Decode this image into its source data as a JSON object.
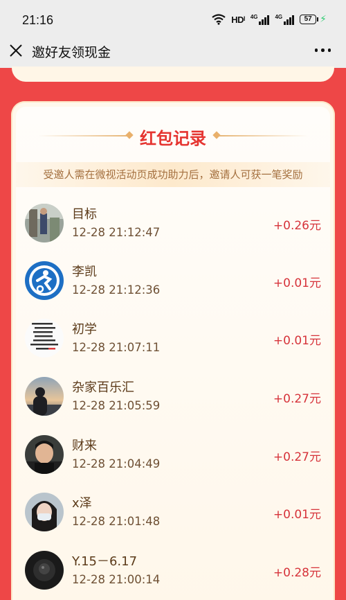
{
  "status_bar": {
    "time": "21:16",
    "network_label": "HDᴵ",
    "signal_tag": "4G",
    "battery": "57",
    "charging_color": "#2ecc71"
  },
  "nav": {
    "close_icon": "close-icon",
    "title": "邀好友领现金",
    "more_icon": "more-icon"
  },
  "section": {
    "title": "红包记录",
    "notice": "受邀人需在微视活动页成功助力后，邀请人可获一笔奖励"
  },
  "colors": {
    "background": "#ee4747",
    "accent_red": "#e53430",
    "amount_red": "#d6333a",
    "name_brown": "#5c3b1a",
    "notice_brown": "#a4703f"
  },
  "records": [
    {
      "name": "目标",
      "time": "12-28 21:12:47",
      "amount": "+0.26元",
      "avatar": "outdoor-photo"
    },
    {
      "name": "李凯",
      "time": "12-28 21:12:36",
      "amount": "+0.01元",
      "avatar": "blue-logo"
    },
    {
      "name": "初学",
      "time": "12-28 21:07:11",
      "amount": "+0.01元",
      "avatar": "text-image"
    },
    {
      "name": "杂家百乐汇",
      "time": "12-28 21:05:59",
      "amount": "+0.27元",
      "avatar": "sunset-silhouette"
    },
    {
      "name": "财来",
      "time": "12-28 21:04:49",
      "amount": "+0.27元",
      "avatar": "man-portrait"
    },
    {
      "name": "x泽",
      "time": "12-28 21:01:48",
      "amount": "+0.01元",
      "avatar": "masked-portrait"
    },
    {
      "name": "Y.15－6.17",
      "time": "12-28 21:00:14",
      "amount": "+0.28元",
      "avatar": "dark-photo"
    }
  ]
}
